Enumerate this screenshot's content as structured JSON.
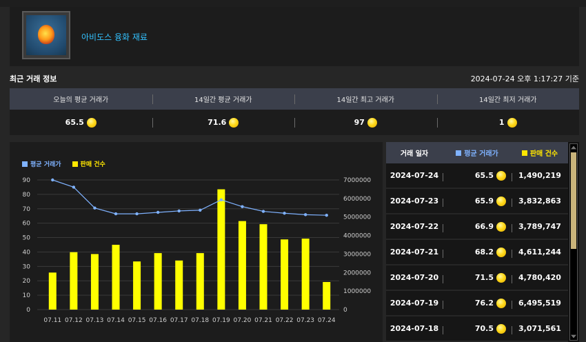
{
  "item": {
    "name": "아비도스 융화 재료",
    "icon": "abidos-fusion-material-gem-icon"
  },
  "section_title": "최근 거래 정보",
  "timestamp": "2024-07-24 오후 1:17:27 기준",
  "stats": {
    "headers": [
      "오늘의 평균 거래가",
      "14일간 평균 거래가",
      "14일간 최고 거래가",
      "14일간 최저 거래가"
    ],
    "values": [
      "65.5",
      "71.6",
      "97",
      "1"
    ]
  },
  "legend": {
    "avg": "평균 거래가",
    "volume": "판매 건수"
  },
  "colors": {
    "avg_line": "#7fb2ff",
    "volume_bar": "#ffff00",
    "item_name": "#33c2ff",
    "coin": "#ffd91a"
  },
  "chart_data": {
    "type": "bar",
    "categories": [
      "07.11",
      "07.12",
      "07.13",
      "07.14",
      "07.15",
      "07.16",
      "07.17",
      "07.18",
      "07.19",
      "07.20",
      "07.21",
      "07.22",
      "07.23",
      "07.24"
    ],
    "series": [
      {
        "name": "판매 건수",
        "type": "bar",
        "axis": "right",
        "values": [
          2000000,
          3100000,
          3000000,
          3500000,
          2600000,
          3050000,
          2650000,
          3050000,
          6495519,
          4780420,
          4611244,
          3789747,
          3832863,
          1490219
        ]
      },
      {
        "name": "평균 거래가",
        "type": "line",
        "axis": "left",
        "values": [
          90,
          85,
          70.5,
          66.5,
          66.5,
          67.5,
          68.5,
          69,
          76.2,
          71.5,
          68.2,
          66.9,
          65.9,
          65.5
        ]
      }
    ],
    "y_left": {
      "ylim": [
        0,
        90
      ],
      "ticks": [
        "0",
        "10",
        "20",
        "30",
        "40",
        "50",
        "60",
        "70",
        "80",
        "90"
      ]
    },
    "y_right": {
      "ylim": [
        0,
        7000000
      ],
      "ticks": [
        "0",
        "1000000",
        "2000000",
        "3000000",
        "4000000",
        "5000000",
        "6000000",
        "7000000"
      ]
    },
    "grid": true,
    "legend_position": "top-left"
  },
  "table": {
    "headers": {
      "date": "거래 일자",
      "avg": "평균 거래가",
      "volume": "판매 건수"
    },
    "rows": [
      {
        "date": "2024-07-24",
        "avg": "65.5",
        "volume": "1,490,219"
      },
      {
        "date": "2024-07-23",
        "avg": "65.9",
        "volume": "3,832,863"
      },
      {
        "date": "2024-07-22",
        "avg": "66.9",
        "volume": "3,789,747"
      },
      {
        "date": "2024-07-21",
        "avg": "68.2",
        "volume": "4,611,244"
      },
      {
        "date": "2024-07-20",
        "avg": "71.5",
        "volume": "4,780,420"
      },
      {
        "date": "2024-07-19",
        "avg": "76.2",
        "volume": "6,495,519"
      },
      {
        "date": "2024-07-18",
        "avg": "70.5",
        "volume": "3,071,561"
      }
    ]
  }
}
